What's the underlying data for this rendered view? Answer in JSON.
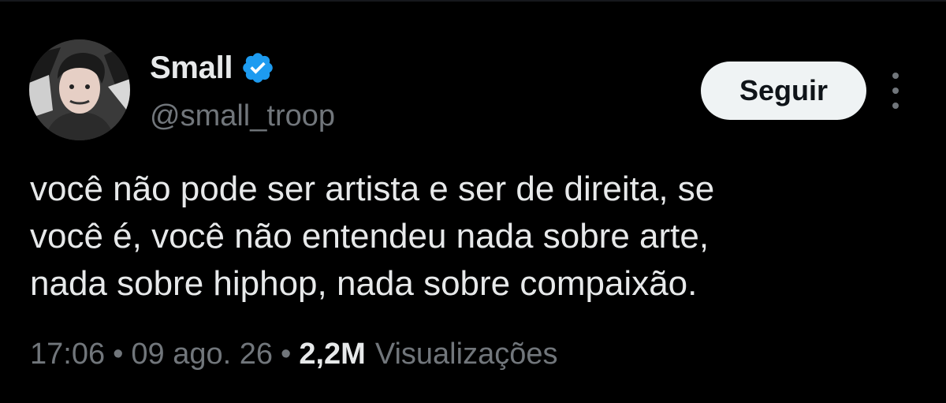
{
  "author": {
    "display_name": "Small",
    "handle": "@small_troop",
    "verified": true,
    "verified_icon": "verified-badge-icon",
    "avatar_icon": "avatar-image"
  },
  "actions": {
    "follow_label": "Seguir",
    "more_icon": "more-options-icon"
  },
  "tweet": {
    "text": "você não pode ser artista e ser de direita, se\nvocê é, você não entendeu nada sobre arte,\nnada sobre hiphop, nada sobre compaixão.",
    "time": "17:06",
    "date": "09 ago. 26",
    "separator": "•",
    "views_count": "2,2M",
    "views_label": "Visualizações"
  },
  "colors": {
    "background": "#000000",
    "primary_text": "#e7e9ea",
    "secondary_text": "#71767b",
    "verified_blue": "#1d9bf0",
    "follow_bg": "#eff3f4"
  }
}
